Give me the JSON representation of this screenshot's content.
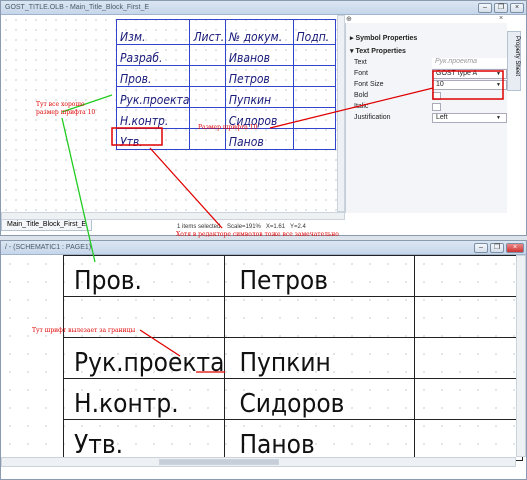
{
  "top_window": {
    "title": "GOST_TITLE.OLB - Main_Title_Block_First_E",
    "table": [
      [
        "Изм.",
        "Лист.",
        "№ докум.",
        "Подп."
      ],
      [
        "Разраб.",
        "",
        "Иванов",
        ""
      ],
      [
        "Пров.",
        "",
        "Петров",
        ""
      ],
      [
        "Рук.проекта",
        "",
        "Пупкин",
        ""
      ],
      [
        "Н.контр.",
        "",
        "Сидоров",
        ""
      ],
      [
        "Утв.",
        "",
        "Панов",
        ""
      ]
    ],
    "tab_label": "Main_Title_Block_First_E",
    "status": {
      "selected": "1 items selected",
      "scale": "Scale=191%",
      "x": "X=1.61",
      "y": "Y=2.4"
    }
  },
  "properties": {
    "section1": "Symbol Properties",
    "section2": "Text Properties",
    "side_tab": "Property Sheet",
    "rows": [
      {
        "key": "Text",
        "value": "Рук.проекта"
      },
      {
        "key": "Font",
        "value": "GOST type A"
      },
      {
        "key": "Font Size",
        "value": "10"
      },
      {
        "key": "Bold",
        "value": ""
      },
      {
        "key": "Italic",
        "value": ""
      },
      {
        "key": "Justification",
        "value": "Left"
      }
    ]
  },
  "bottom_window": {
    "title": "/ - (SCHEMATIC1 : PAGE1)",
    "rows": [
      [
        "Пров.",
        "Петров"
      ],
      [
        "",
        ""
      ],
      [
        "Рук.проекта",
        "Пупкин"
      ],
      [
        "Н.контр.",
        "Сидоров"
      ],
      [
        "Утв.",
        "Панов"
      ]
    ]
  },
  "annotations": {
    "a1": "Тут все хорошо\nразмер шрифта 10",
    "a2": "Размер шрифта 10",
    "a3": "Хотя в редакторе символов тоже все замечательно",
    "a4": "Тут шрифт вылезает за границы"
  },
  "colors": {
    "annotation": "#e00000",
    "arrow_green": "#22cc22",
    "table_blue": "#3344cc"
  }
}
